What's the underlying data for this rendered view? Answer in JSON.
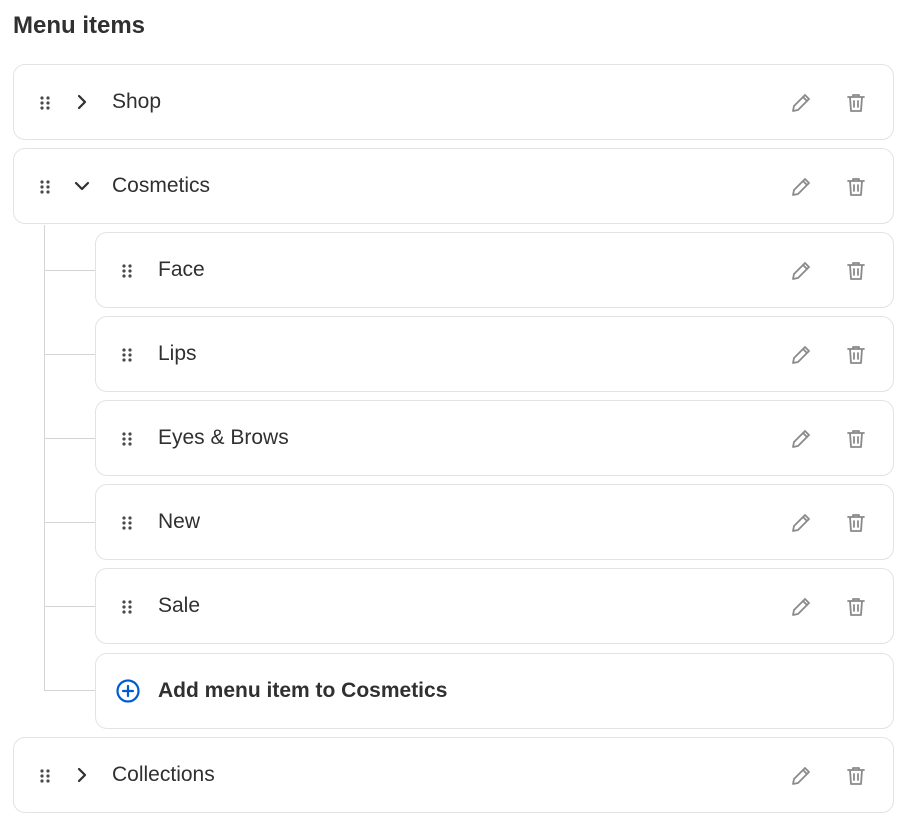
{
  "section_title": "Menu items",
  "colors": {
    "accent": "#005bd3",
    "icon": "#8a8a8a",
    "border": "#e3e3e3",
    "text": "#303030"
  },
  "items": [
    {
      "label": "Shop",
      "expanded": false
    },
    {
      "label": "Cosmetics",
      "expanded": true,
      "children": [
        {
          "label": "Face"
        },
        {
          "label": "Lips"
        },
        {
          "label": "Eyes & Brows"
        },
        {
          "label": "New"
        },
        {
          "label": "Sale"
        }
      ],
      "add_label": "Add menu item to Cosmetics"
    },
    {
      "label": "Collections",
      "expanded": false
    }
  ]
}
